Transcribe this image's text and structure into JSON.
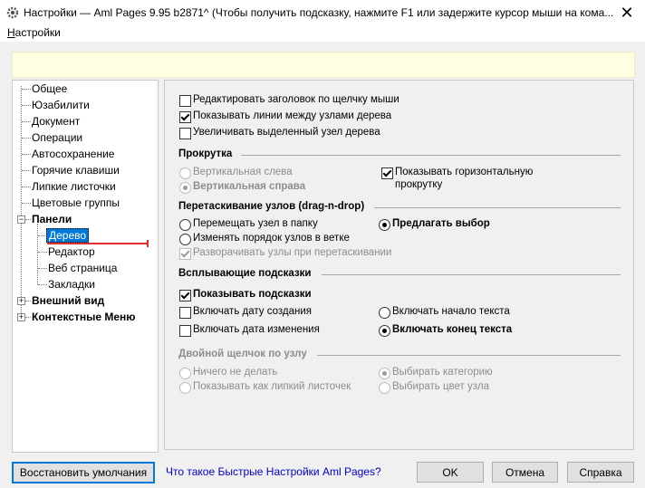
{
  "window": {
    "title": "Настройки  — Aml Pages 9.95 b2871^ (Чтобы получить подсказку, нажмите F1 или задержите курсор мыши на кома...",
    "close_glyph": "✕"
  },
  "menubar": {
    "item_first": "Н",
    "item_rest": "астройки"
  },
  "tree": {
    "items": [
      "Общее",
      "Юзабилити",
      "Документ",
      "Операции",
      "Автосохранение",
      "Горячие клавиши",
      "Липкие листочки",
      "Цветовые группы",
      "Панели",
      "Дерево",
      "Редактор",
      "Веб страница",
      "Закладки",
      "Внешний вид",
      "Контекстные Меню"
    ],
    "collapse_glyph": "−",
    "expand_glyph": "+"
  },
  "options": {
    "edit_header": "Редактировать заголовок по щелчку мыши",
    "show_lines": "Показывать линии между узлами дерева",
    "enlarge_selected": "Увеличивать выделенный узел дерева"
  },
  "scroll": {
    "title": "Прокрутка",
    "vertical_left": "Вертикальная слева",
    "vertical_right": "Вертикальная справа",
    "show_horizontal_1": "Показывать горизонтальную",
    "show_horizontal_2": "прокрутку"
  },
  "drag": {
    "title": "Перетаскивание узлов (drag-n-drop)",
    "move_to_folder": "Перемещать узел в папку",
    "offer_choice": "Предлагать выбор",
    "change_order": "Изменять порядок узлов в ветке",
    "expand_on_drag": "Разворачивать узлы при перетаскивании"
  },
  "tooltips": {
    "title": "Всплывающие подсказки",
    "show_tooltips": "Показывать подсказки",
    "include_created": "Включать дату создания",
    "include_text_start": "Включать начало текста",
    "include_modified": "Включать дата изменения",
    "include_text_end": "Включать конец текста"
  },
  "dblclick": {
    "title": "Двойной щелчок по узлу",
    "do_nothing": "Ничего не делать",
    "select_category": "Выбирать категорию",
    "show_sticky": "Показывать как липкий листочек",
    "select_color": "Выбирать цвет узла"
  },
  "footer": {
    "restore": "Восстановить умолчания",
    "link": "Что такое Быстрые Настройки Aml Pages?",
    "ok": "OK",
    "cancel": "Отмена",
    "help": "Справка"
  },
  "colors": {
    "accent": "#0078d7",
    "hint_bg": "#ffffe1",
    "annotation_red": "#e0302a"
  }
}
